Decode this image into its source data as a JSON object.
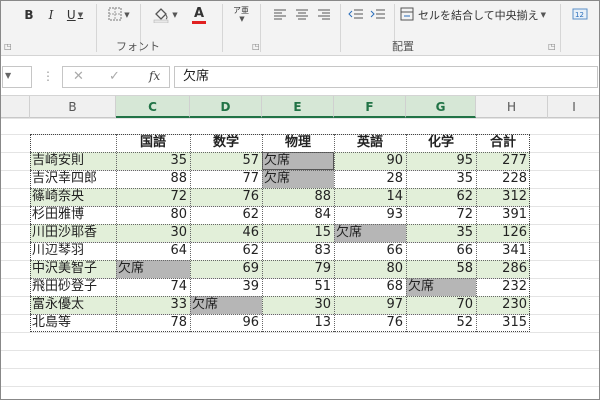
{
  "ribbon": {
    "bold": "B",
    "italic": "I",
    "underline": "U",
    "font_color_letter": "A",
    "merge_label": "セルを結合して中央揃え",
    "font_group_label": "フォント",
    "alignment_group_label": "配置"
  },
  "formula_bar": {
    "fx": "fx",
    "content": "欠席"
  },
  "columns": [
    "B",
    "C",
    "D",
    "E",
    "F",
    "G",
    "H",
    "I"
  ],
  "selected_columns": [
    "C",
    "D",
    "E",
    "F",
    "G"
  ],
  "table": {
    "headers": [
      "",
      "国語",
      "数学",
      "物理",
      "英語",
      "化学",
      "合計"
    ],
    "rows": [
      [
        "吉崎安則",
        "35",
        "57",
        "欠席",
        "90",
        "95",
        "277"
      ],
      [
        "吉沢幸四郎",
        "88",
        "77",
        "欠席",
        "28",
        "35",
        "228"
      ],
      [
        "篠崎奈央",
        "72",
        "76",
        "88",
        "14",
        "62",
        "312"
      ],
      [
        "杉田雅博",
        "80",
        "62",
        "84",
        "93",
        "72",
        "391"
      ],
      [
        "川田沙耶香",
        "30",
        "46",
        "15",
        "欠席",
        "35",
        "126"
      ],
      [
        "川辺琴羽",
        "64",
        "62",
        "83",
        "66",
        "66",
        "341"
      ],
      [
        "中沢美智子",
        "欠席",
        "69",
        "79",
        "80",
        "58",
        "286"
      ],
      [
        "飛田砂登子",
        "74",
        "39",
        "51",
        "68",
        "欠席",
        "232"
      ],
      [
        "富永優太",
        "33",
        "欠席",
        "30",
        "97",
        "70",
        "230"
      ],
      [
        "北島等",
        "78",
        "96",
        "13",
        "76",
        "52",
        "315"
      ]
    ]
  },
  "colors": {
    "accent": "#217346",
    "band": "#e2efd9",
    "absent": "#b6b6b6"
  }
}
